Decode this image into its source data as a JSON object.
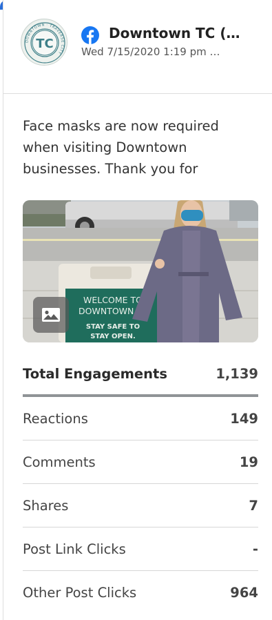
{
  "post": {
    "page_name": "Downtown TC (…",
    "date": "Wed 7/15/2020 1:19 pm …",
    "text": "Face masks are now required when visiting Downtown businesses. Thank you for",
    "platform_icon": "facebook-icon",
    "avatar_text": "TC",
    "avatar_ring_text": "DOWNTOWN · TRAVERSE CITY"
  },
  "photo": {
    "sign_line1": "WELCOME TO",
    "sign_line2": "DOWNTOWN TC",
    "sign_line3": "STAY SAFE TO",
    "sign_line4": "STAY OPEN.",
    "badge_icon": "image-icon"
  },
  "stats": {
    "total": {
      "label": "Total Engagements",
      "value": "1,139"
    },
    "rows": [
      {
        "label": "Reactions",
        "value": "149"
      },
      {
        "label": "Comments",
        "value": "19"
      },
      {
        "label": "Shares",
        "value": "7"
      },
      {
        "label": "Post Link Clicks",
        "value": "-"
      },
      {
        "label": "Other Post Clicks",
        "value": "964"
      }
    ]
  },
  "colors": {
    "accent_bar": "#2a6ed9",
    "facebook": "#1877f2",
    "avatar_ring": "#3e7f88"
  }
}
